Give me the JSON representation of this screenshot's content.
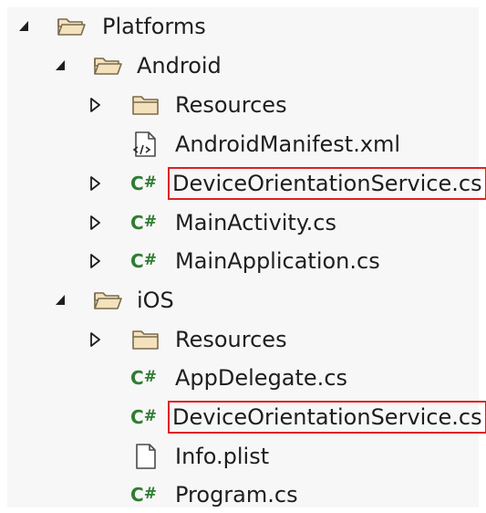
{
  "solution_explorer": {
    "nodes": [
      {
        "label": "Platforms",
        "expander": "expanded",
        "icon": "folder-open-icon"
      },
      {
        "label": "Android",
        "expander": "expanded",
        "icon": "folder-open-icon"
      },
      {
        "label": "Resources",
        "expander": "collapsed",
        "icon": "folder-icon"
      },
      {
        "label": "AndroidManifest.xml",
        "expander": "none",
        "icon": "xml-file-icon"
      },
      {
        "label": "DeviceOrientationService.cs",
        "expander": "collapsed",
        "icon": "csharp-file-icon",
        "highlighted": true
      },
      {
        "label": "MainActivity.cs",
        "expander": "collapsed",
        "icon": "csharp-file-icon"
      },
      {
        "label": "MainApplication.cs",
        "expander": "collapsed",
        "icon": "csharp-file-icon"
      },
      {
        "label": "iOS",
        "expander": "expanded",
        "icon": "folder-open-icon"
      },
      {
        "label": "Resources",
        "expander": "collapsed",
        "icon": "folder-icon"
      },
      {
        "label": "AppDelegate.cs",
        "expander": "none",
        "icon": "csharp-file-icon"
      },
      {
        "label": "DeviceOrientationService.cs",
        "expander": "none",
        "icon": "csharp-file-icon",
        "highlighted": true
      },
      {
        "label": "Info.plist",
        "expander": "none",
        "icon": "file-icon"
      },
      {
        "label": "Program.cs",
        "expander": "none",
        "icon": "csharp-file-icon"
      }
    ]
  },
  "colors": {
    "highlight_border": "#e02020",
    "folder_fill": "#f3e2bc",
    "folder_stroke": "#7a6a4f",
    "csharp_green": "#2f7d32"
  }
}
